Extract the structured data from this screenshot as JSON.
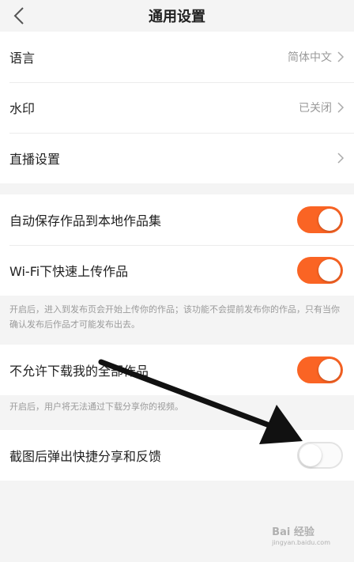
{
  "header": {
    "title": "通用设置",
    "back_icon": "chevron-left-icon"
  },
  "group1": [
    {
      "label": "语言",
      "value": "简体中文"
    },
    {
      "label": "水印",
      "value": "已关闭"
    },
    {
      "label": "直播设置",
      "value": ""
    }
  ],
  "group2": [
    {
      "label": "自动保存作品到本地作品集",
      "enabled": true
    },
    {
      "label": "Wi-Fi下快速上传作品",
      "enabled": true
    }
  ],
  "note1": "开启后，进入到发布页会开始上传你的作品；该功能不会提前发布你的作品，只有当你确认发布后作品才可能发布出去。",
  "group3": {
    "label": "不允许下载我的全部作品",
    "enabled": true
  },
  "note2": "开启后，用户将无法通过下载分享你的视频。",
  "group4": {
    "label": "截图后弹出快捷分享和反馈",
    "enabled": false
  },
  "watermark": {
    "text": "Bai 经验",
    "sub": "jingyan.baidu.com"
  },
  "colors": {
    "accent": "#fa6424",
    "background": "#f4f4f4"
  }
}
